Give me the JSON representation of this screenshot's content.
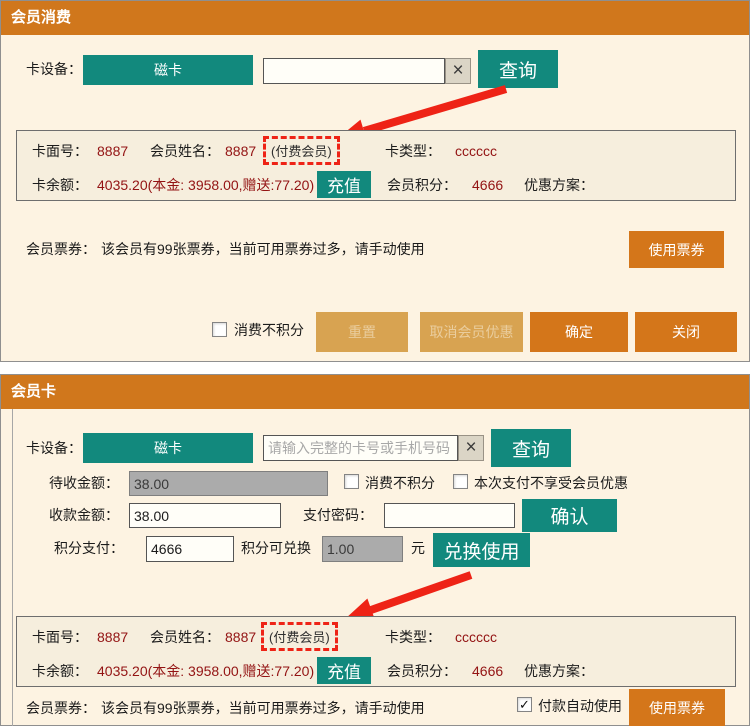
{
  "colors": {
    "title_bar": "#d0771c",
    "dialog_background": "#fdf3e2",
    "teal_button": "#12897d",
    "orange_button": "#d4761a",
    "orange_button_disabled": "#d8a351",
    "value_text": "#931313",
    "annotation_red": "#ee2316"
  },
  "member_panel": {
    "card_no_label": "卡面号：",
    "card_no": "8887",
    "name_label": "会员姓名：",
    "name": "8887",
    "paid_member_badge": "(付费会员)",
    "card_type_label": "卡类型：",
    "card_type": "cccccc",
    "balance_label": "卡余额：",
    "balance": "4035.20(本金: 3958.00,赠送:77.20)",
    "recharge_button": "充值",
    "points_label": "会员积分：",
    "points": "4666",
    "discount_plan_label": "优惠方案：",
    "discount_plan": ""
  },
  "ticket": {
    "label": "会员票券：",
    "message": "该会员有99张票券，当前可用票券过多，请手动使用",
    "use_button": "使用票券"
  },
  "consume_dialog": {
    "title": "会员消费",
    "device_label": "卡设备：",
    "device_button": "磁卡",
    "card_input_value": "",
    "clear_button": "×",
    "query_button": "查询",
    "no_points_checkbox_label": "消费不积分",
    "reset_button": "重置",
    "cancel_member_discount_button": "取消会员优惠",
    "confirm_button": "确定",
    "close_button": "关闭"
  },
  "card_dialog": {
    "title": "会员卡",
    "device_label": "卡设备：",
    "device_button": "磁卡",
    "card_input_placeholder": "请输入完整的卡号或手机号码",
    "clear_button": "×",
    "query_button": "查询",
    "pending_amount_label": "待收金额：",
    "pending_amount": "38.00",
    "no_points_checkbox_label": "消费不积分",
    "no_discount_checkbox_label": "本次支付不享受会员优惠",
    "received_amount_label": "收款金额：",
    "received_amount": "38.00",
    "pay_password_label": "支付密码：",
    "pay_password": "",
    "confirm_button": "确认",
    "points_pay_label": "积分支付：",
    "points_pay": "4666",
    "points_exchange_label": "积分可兑换",
    "points_exchange_amount": "1.00",
    "yuan_unit": "元",
    "exchange_use_button": "兑换使用",
    "auto_use_checkbox_label": "付款自动使用",
    "auto_use_checkmark": "✓"
  }
}
